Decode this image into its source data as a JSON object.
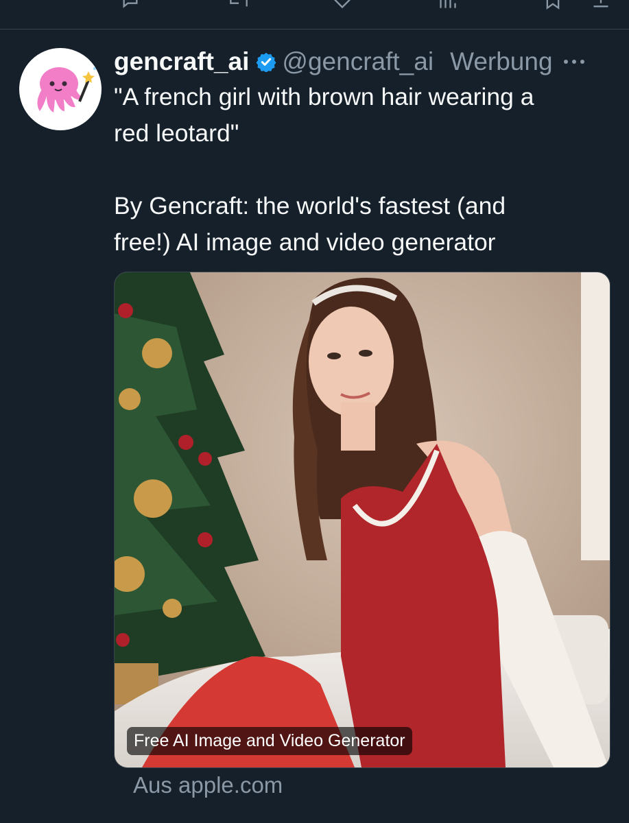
{
  "tweet": {
    "author_name": "gencraft_ai",
    "handle": "@gencraft_ai",
    "ad_label": "Werbung",
    "text_lines": [
      "\"A french girl with brown hair wearing a",
      "red leotard\"",
      "By Gencraft: the world's fastest (and",
      "free!) AI image and video generator"
    ]
  },
  "media": {
    "caption": "Free AI Image and Video Generator"
  },
  "source": "Aus apple.com",
  "icons": {
    "verified": "verified-badge-icon",
    "more": "more-dots-icon",
    "avatar": "octopus-wand-logo"
  },
  "colors": {
    "background": "#15202b",
    "text_primary": "#f7f9f9",
    "text_secondary": "#8b98a5",
    "verified": "#1d9bf0",
    "avatar_octopus": "#f27ec8"
  }
}
